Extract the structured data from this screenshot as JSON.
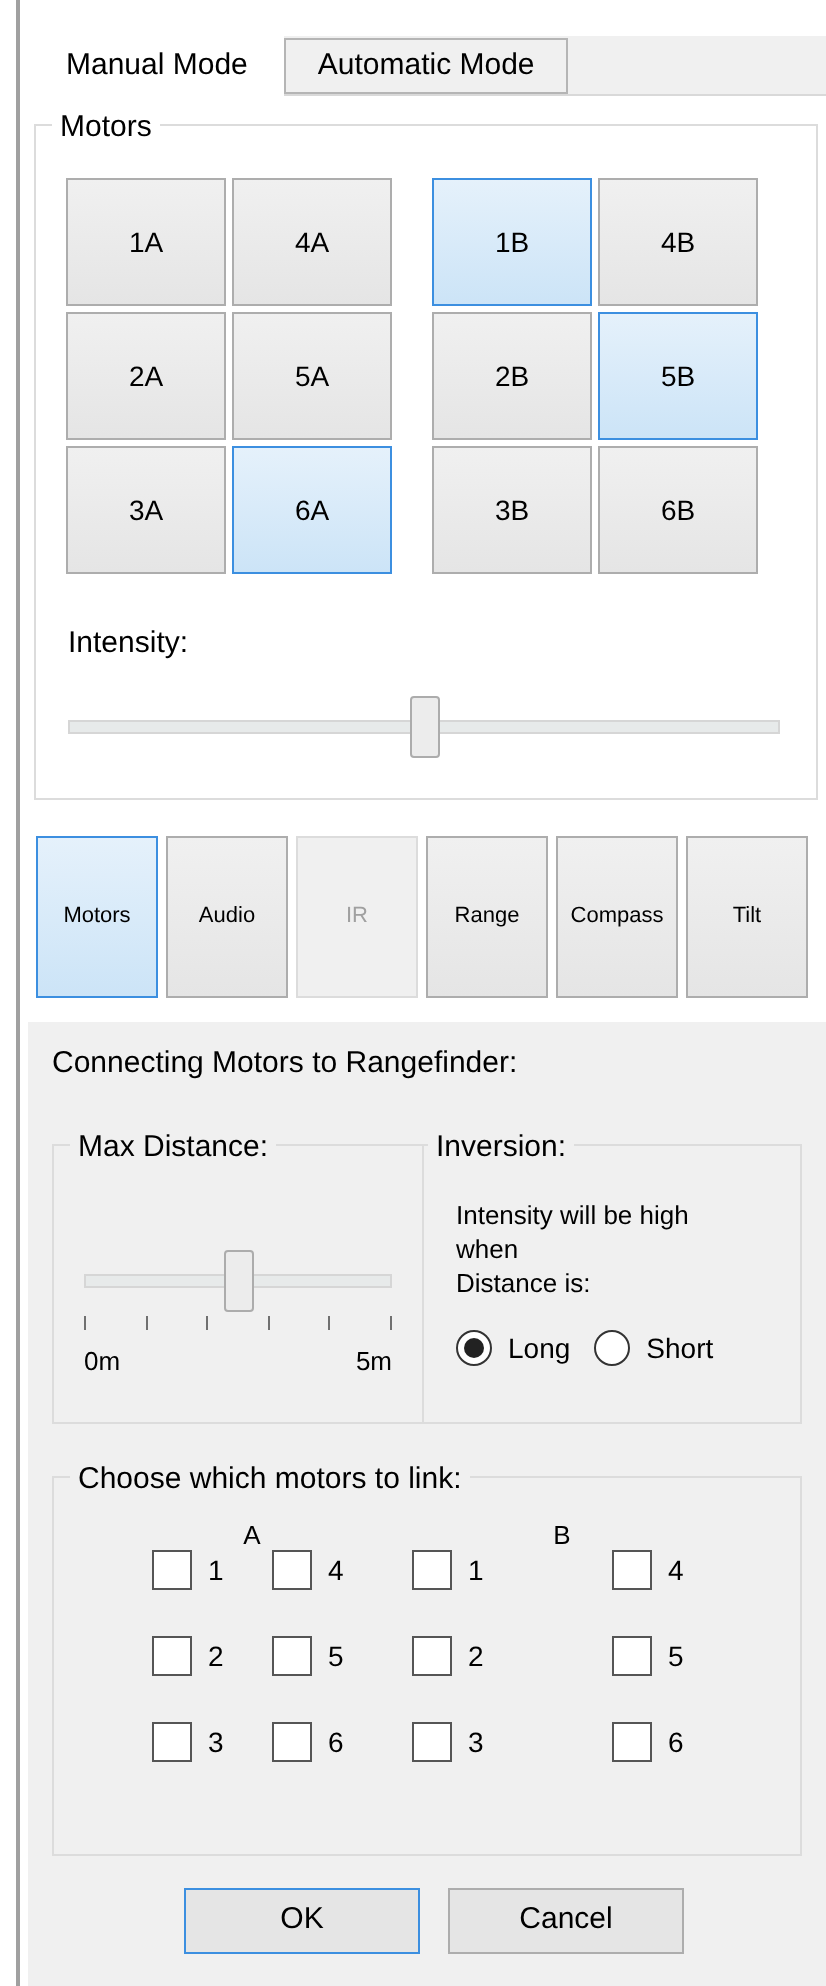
{
  "tabs": [
    {
      "label": "Manual Mode",
      "selected": true
    },
    {
      "label": "Automatic Mode",
      "selected": false
    }
  ],
  "motors": {
    "title": "Motors",
    "groups": [
      {
        "buttons": [
          {
            "label": "1A",
            "selected": false
          },
          {
            "label": "4A",
            "selected": false
          },
          {
            "label": "2A",
            "selected": false
          },
          {
            "label": "5A",
            "selected": false
          },
          {
            "label": "3A",
            "selected": false
          },
          {
            "label": "6A",
            "selected": true
          }
        ]
      },
      {
        "buttons": [
          {
            "label": "1B",
            "selected": true
          },
          {
            "label": "4B",
            "selected": false
          },
          {
            "label": "2B",
            "selected": false
          },
          {
            "label": "5B",
            "selected": true
          },
          {
            "label": "3B",
            "selected": false
          },
          {
            "label": "6B",
            "selected": false
          }
        ]
      }
    ],
    "intensity": {
      "label": "Intensity:",
      "level": 0.5
    }
  },
  "sensors": [
    {
      "label": "Motors",
      "selected": true,
      "disabled": false
    },
    {
      "label": "Audio",
      "selected": false,
      "disabled": false
    },
    {
      "label": "IR",
      "selected": false,
      "disabled": true
    },
    {
      "label": "Range",
      "selected": false,
      "disabled": false
    },
    {
      "label": "Compass",
      "selected": false,
      "disabled": false
    },
    {
      "label": "Tilt",
      "selected": false,
      "disabled": false
    }
  ],
  "panel": {
    "title": "Connecting Motors to Rangefinder:",
    "max_distance": {
      "title": "Max Distance:",
      "level": 0.5,
      "min_label": "0m",
      "max_label": "5m"
    },
    "inversion": {
      "title": "Inversion:",
      "lines": [
        "Intensity will be high when",
        "Distance is:"
      ],
      "options": [
        {
          "label": "Long",
          "selected": true
        },
        {
          "label": "Short",
          "selected": false
        }
      ]
    },
    "link": {
      "title": "Choose which motors to link:",
      "columns": [
        {
          "heading": "A",
          "items": [
            {
              "label": "1",
              "checked": false
            },
            {
              "label": "2",
              "checked": false
            },
            {
              "label": "3",
              "checked": false
            },
            {
              "label": "4",
              "checked": false
            },
            {
              "label": "5",
              "checked": false
            },
            {
              "label": "6",
              "checked": false
            }
          ]
        },
        {
          "heading": "B",
          "items": [
            {
              "label": "1",
              "checked": false
            },
            {
              "label": "2",
              "checked": false
            },
            {
              "label": "3",
              "checked": false
            },
            {
              "label": "4",
              "checked": false
            },
            {
              "label": "5",
              "checked": false
            },
            {
              "label": "6",
              "checked": false
            }
          ]
        }
      ]
    },
    "buttons": [
      {
        "label": "OK",
        "default": true
      },
      {
        "label": "Cancel",
        "default": false
      }
    ]
  }
}
